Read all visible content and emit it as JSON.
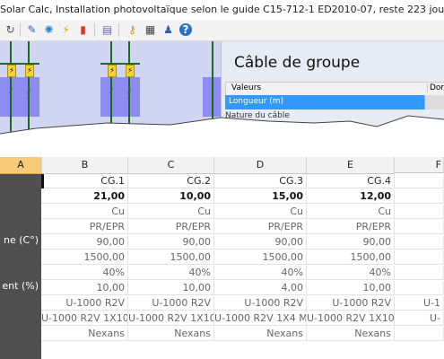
{
  "window": {
    "title": "Solar Calc, Installation photovoltaïque selon le guide C15-712-1 ED2010-07, reste 223 jours"
  },
  "toolbar": {
    "icons": [
      "refresh-icon",
      "edit-icon",
      "settings-icon",
      "lightning-icon",
      "chart-icon",
      "book-icon",
      "key-icon",
      "calculator-icon",
      "user-icon",
      "help-icon"
    ]
  },
  "properties": {
    "title": "Câble de groupe",
    "header_values": "Valeurs",
    "header_data": "Don",
    "selected_row": "Longueur (m)",
    "next_row": "Nature du câble"
  },
  "sheet": {
    "columns": [
      "A",
      "B",
      "C",
      "D",
      "E",
      "F"
    ],
    "row_labels": [
      "",
      "",
      "",
      "ne (C°)",
      "",
      "ent (%)",
      "",
      "",
      "",
      ""
    ],
    "rows": [
      [
        "CG.1",
        "CG.2",
        "CG.3",
        "CG.4",
        ""
      ],
      [
        "21,00",
        "10,00",
        "15,00",
        "12,00",
        ""
      ],
      [
        "Cu",
        "Cu",
        "Cu",
        "Cu",
        ""
      ],
      [
        "PR/EPR",
        "PR/EPR",
        "PR/EPR",
        "PR/EPR",
        ""
      ],
      [
        "90,00",
        "90,00",
        "90,00",
        "90,00",
        ""
      ],
      [
        "1500,00",
        "1500,00",
        "1500,00",
        "1500,00",
        ""
      ],
      [
        "40%",
        "40%",
        "40%",
        "40%",
        ""
      ],
      [
        "10,00",
        "10,00",
        "4,00",
        "10,00",
        ""
      ],
      [
        "U-1000 R2V",
        "U-1000 R2V",
        "U-1000 R2V",
        "U-1000 R2V",
        "U-1"
      ],
      [
        "U-1000 R2V 1X10",
        "U-1000 R2V 1X10",
        "U-1000 R2V 1X4 M",
        "U-1000 R2V 1X10",
        "U-"
      ],
      [
        "Nexans",
        "Nexans",
        "Nexans",
        "Nexans",
        ""
      ]
    ]
  },
  "colors": {
    "diagram_bg": "#cfd5f2",
    "selection": "#3399ff",
    "column_header_selected": "#f6ca79",
    "row_header_bg": "#4f4f4f"
  }
}
